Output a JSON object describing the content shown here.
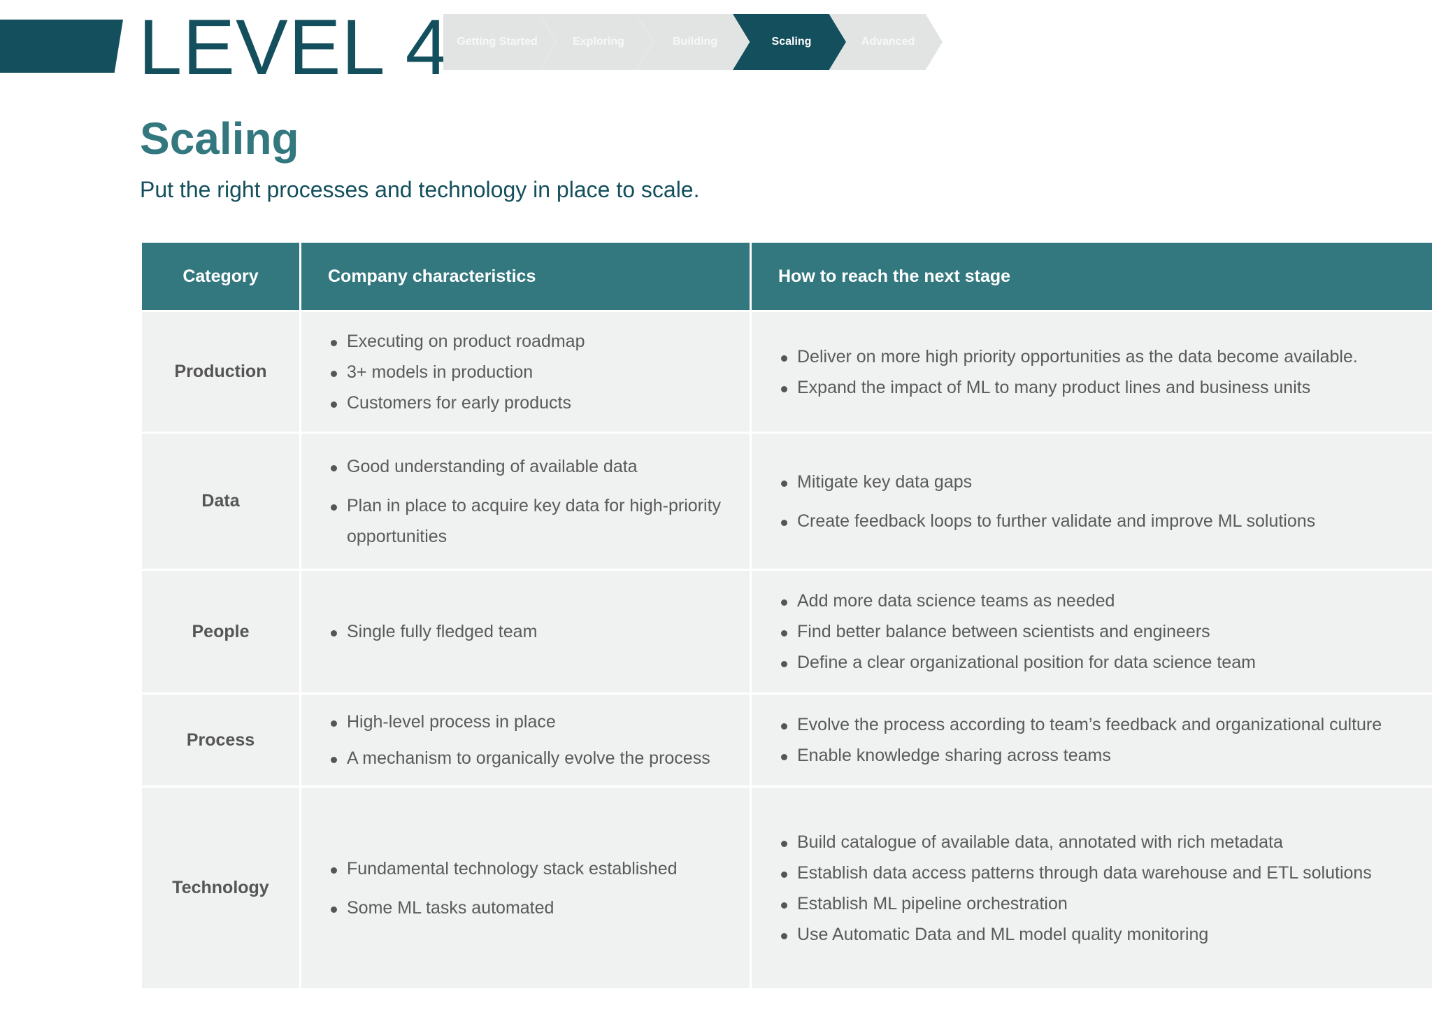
{
  "header": {
    "level": "LEVEL 4",
    "stages": [
      {
        "label": "Getting Started",
        "active": false
      },
      {
        "label": "Exploring",
        "active": false
      },
      {
        "label": "Building",
        "active": false
      },
      {
        "label": "Scaling",
        "active": true
      },
      {
        "label": "Advanced",
        "active": false
      }
    ]
  },
  "page": {
    "title": "Scaling",
    "subtitle": "Put the right processes and technology in place to scale."
  },
  "table": {
    "headers": [
      "Category",
      "Company characteristics",
      "How to reach the next stage"
    ],
    "rows": [
      {
        "category": "Production",
        "characteristics": [
          "Executing on product roadmap",
          "3+ models in production",
          "Customers for early products"
        ],
        "next_steps": [
          "Deliver on more high priority opportunities as the data become available.",
          "Expand the impact of ML to many product lines and business units"
        ]
      },
      {
        "category": "Data",
        "characteristics": [
          "Good understanding of available data",
          "Plan in place to acquire key data for high-priority opportunities"
        ],
        "next_steps": [
          "Mitigate key data gaps",
          "Create feedback loops to further validate and improve ML solutions"
        ]
      },
      {
        "category": "People",
        "characteristics": [
          "Single fully fledged team"
        ],
        "next_steps": [
          "Add more data science teams as needed",
          "Find better balance between scientists and engineers",
          "Define a clear organizational position for data science team"
        ]
      },
      {
        "category": "Process",
        "characteristics": [
          "High-level process in place",
          "A mechanism to organically evolve the process"
        ],
        "next_steps": [
          "Evolve the process according to team’s feedback and organizational culture",
          "Enable knowledge sharing across teams"
        ]
      },
      {
        "category": "Technology",
        "characteristics": [
          "Fundamental technology stack established",
          "Some ML tasks automated"
        ],
        "next_steps": [
          "Build catalogue of available data, annotated with rich metadata",
          "Establish data access patterns through data warehouse and ETL solutions",
          "Establish ML pipeline orchestration",
          "Use Automatic Data and ML model quality monitoring"
        ]
      }
    ]
  },
  "colors": {
    "dark_teal": "#134f5c",
    "teal": "#33787f",
    "stage_inactive": "#e2e4e4",
    "cell_background": "#f0f1f1"
  }
}
